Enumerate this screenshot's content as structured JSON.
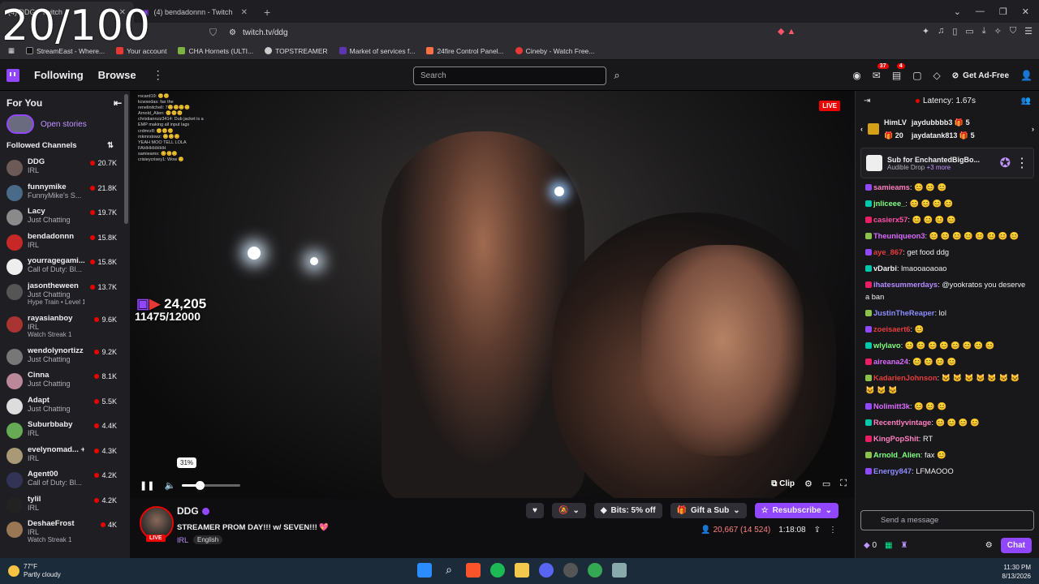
{
  "overlay_counter": "20/100",
  "browser": {
    "tabs": [
      {
        "title": "(4) DDG - Twitch"
      },
      {
        "title": "(4) bendadonnn - Twitch"
      }
    ],
    "url": "twitch.tv/ddg",
    "bookmarks": [
      "StreamEast - Where...",
      "Your account",
      "CHA Hornets (ULTI...",
      "TOPSTREAMER",
      "Market of services f...",
      "24fire Control Panel...",
      "Cineby - Watch Free..."
    ]
  },
  "twitch_nav": {
    "following": "Following",
    "browse": "Browse",
    "search_placeholder": "Search",
    "notif_count": "37",
    "inbox_count": "4",
    "get_ad_free": "Get Ad-Free"
  },
  "sidebar": {
    "for_you": "For You",
    "open_stories": "Open stories",
    "followed_channels": "Followed Channels",
    "channels": [
      {
        "name": "DDG",
        "game": "IRL",
        "viewers": "20.7K",
        "extra": "",
        "color": "#6b5a55"
      },
      {
        "name": "funnymike",
        "game": "FunnyMike's S...",
        "viewers": "21.8K",
        "extra": "",
        "color": "#4a6a8a"
      },
      {
        "name": "Lacy",
        "game": "Just Chatting",
        "viewers": "19.7K",
        "extra": "",
        "color": "#8a8a8a"
      },
      {
        "name": "bendadonnn",
        "game": "IRL",
        "viewers": "15.8K",
        "extra": "",
        "color": "#c62828"
      },
      {
        "name": "yourragegami...",
        "game": "Call of Duty: Bl...",
        "viewers": "15.8K",
        "extra": "",
        "color": "#eeeeee"
      },
      {
        "name": "jasontheween",
        "game": "Just Chatting",
        "viewers": "13.7K",
        "extra": "Hype Train • Level 1",
        "color": "#555"
      },
      {
        "name": "rayasianboy",
        "game": "IRL",
        "viewers": "9.6K",
        "extra": "Watch Streak 1",
        "color": "#a33"
      },
      {
        "name": "wendolynortizz",
        "game": "Just Chatting",
        "viewers": "9.2K",
        "extra": "",
        "color": "#777"
      },
      {
        "name": "Cinna",
        "game": "Just Chatting",
        "viewers": "8.1K",
        "extra": "",
        "color": "#b89"
      },
      {
        "name": "Adapt",
        "game": "Just Chatting",
        "viewers": "5.5K",
        "extra": "",
        "color": "#ddd"
      },
      {
        "name": "Suburbbaby",
        "game": "IRL",
        "viewers": "4.4K",
        "extra": "",
        "color": "#6a5"
      },
      {
        "name": "evelynomad... +1",
        "game": "IRL",
        "viewers": "4.3K",
        "extra": "",
        "color": "#a97"
      },
      {
        "name": "Agent00",
        "game": "Call of Duty: Bl...",
        "viewers": "4.2K",
        "extra": "",
        "color": "#335"
      },
      {
        "name": "tylil",
        "game": "IRL",
        "viewers": "4.2K",
        "extra": "",
        "color": "#222"
      },
      {
        "name": "DeshaeFrost",
        "game": "IRL",
        "viewers": "4K",
        "extra": "Watch Streak 1",
        "color": "#975"
      }
    ]
  },
  "player": {
    "live": "LIVE",
    "views": "24,205",
    "subs": "11475/12000",
    "volume_tip": "31%",
    "volume": 0.31,
    "clip": "Clip",
    "overlay_chat": [
      "rocard19: 😊😊",
      "kcwsedas: fax the",
      "renelinitchell: 7😊😊😊😊",
      "Arnold_Alien: 😊😊😊",
      "christianruiz3414: Dub jacket is a",
      "EMP making all input lags",
      "crdmrz8: 😊😊😊",
      "mkmrstowz: 😊😊😊",
      "YEAH MOO TELL LOLA",
      "FAHHHHHHH",
      "samieams: 😊😊😊",
      "crisieycrisey1: Wow 😊"
    ]
  },
  "stream": {
    "streamer": "DDG",
    "title": "STREAMER PROM DAY!!! w/ SEVEN!!! 💖",
    "category": "IRL",
    "tag": "English",
    "bits": "Bits: 5% off",
    "gift": "Gift a Sub",
    "resub": "Resubscribe",
    "viewers": "20,667 (14 524)",
    "uptime": "1:18:08"
  },
  "chat": {
    "latency": "Latency: 1.67s",
    "gifter1": "HimLV",
    "gifter1_count": "20",
    "gifter2": "jaydubbbb3",
    "gifter2_count": "5",
    "gifter3": "jaydatank813",
    "gifter3_count": "5",
    "drop_title": "Sub for EnchantedBigBo...",
    "drop_sub": "Audible Drop",
    "drop_more": "+3 more",
    "messages": [
      {
        "user": "samieams",
        "text": "😊 😊 😊",
        "color": "#ff7fbf"
      },
      {
        "user": "jnliceee_",
        "text": "😊 😊 😊 😊",
        "color": "#7fff7f"
      },
      {
        "user": "casierx57",
        "text": "😊 😊 😊 😊",
        "color": "#ff4fa8"
      },
      {
        "user": "Theuniqueon3",
        "text": "😊 😊 😊 😊 😊 😊 😊 😊",
        "color": "#d86bff"
      },
      {
        "user": "aye_867",
        "text": "get food ddg",
        "color": "#e63c3c"
      },
      {
        "user": "vDarbi",
        "text": "lmaooaoaoao",
        "color": "#efeff1"
      },
      {
        "user": "ihatesummerdays",
        "text": "@yookratos you deserve a ban",
        "color": "#b38cff"
      },
      {
        "user": "JustinTheReaper",
        "text": "lol",
        "color": "#8c8cff"
      },
      {
        "user": "zoeisaert6",
        "text": "😊",
        "color": "#e63c3c"
      },
      {
        "user": "wlylavo",
        "text": "😊 😊 😊 😊 😊 😊 😊 😊",
        "color": "#7fff7f"
      },
      {
        "user": "aireana24",
        "text": "😊 😊 😊 😊",
        "color": "#d86bff"
      },
      {
        "user": "KadarienJohnson",
        "text": "🐱 🐱 🐱 🐱 🐱 🐱 🐱 🐱 🐱 🐱",
        "color": "#e63c3c"
      },
      {
        "user": "Nolimitt3k",
        "text": "😊 😊 😊",
        "color": "#d86bff"
      },
      {
        "user": "Recentlyvintage",
        "text": "😊 😊 😊 😊",
        "color": "#ff7fbf"
      },
      {
        "user": "KingPopShit",
        "text": "RT",
        "color": "#ff7fbf"
      },
      {
        "user": "Arnold_Alien",
        "text": "fax 😊",
        "color": "#7fff7f"
      },
      {
        "user": "Energy847",
        "text": "LFMAOOO",
        "color": "#8c8cff"
      }
    ],
    "input_placeholder": "Send a message",
    "points": "0",
    "chat_btn": "Chat"
  },
  "taskbar": {
    "temp": "77°F",
    "weather": "Partly cloudy",
    "time": "11:30 PM",
    "date": "8/13/2026"
  }
}
